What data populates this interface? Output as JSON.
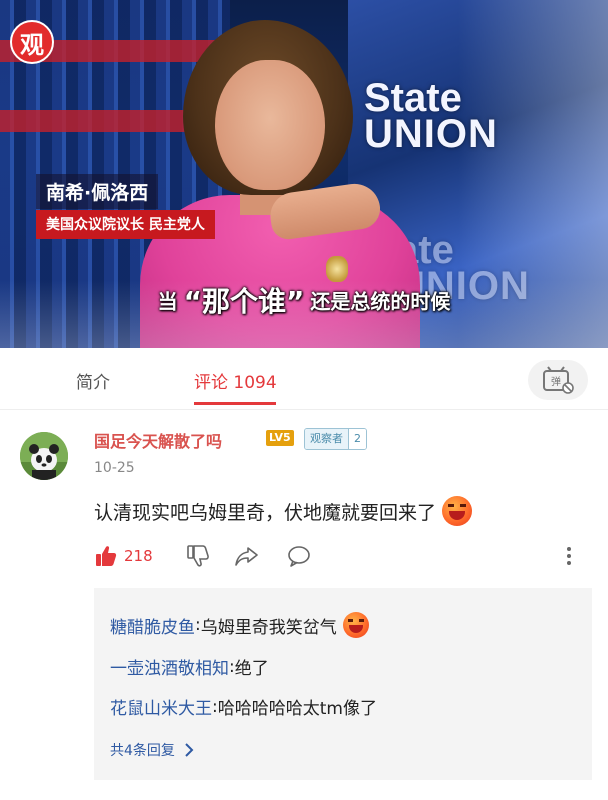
{
  "video": {
    "app_logo": "观",
    "speaker_name": "南希·佩洛西",
    "speaker_title": "美国众议院议长 民主党人",
    "subtitle_before": "当",
    "subtitle_quote": "“那个谁”",
    "subtitle_after": "还是总统的时候",
    "background_logo_line1": "State",
    "background_logo_line2": "UNION",
    "background_logo_ghost_line1": "ate",
    "background_logo_ghost_line2": "UNION"
  },
  "tabs": {
    "intro_label": "简介",
    "comments_label": "评论 1094",
    "active": "comments",
    "danmaku_icon": "danmaku-toggle-icon"
  },
  "comment": {
    "username": "国足今天解散了吗",
    "level_badge": "LV5",
    "observer_label": "观察者",
    "observer_level": "2",
    "date": "10-25",
    "text": "认清现实吧乌姆里奇，伏地魔就要回来了",
    "emoji": "angry-face-icon",
    "like_count": "218"
  },
  "replies": [
    {
      "user": "糖醋脆皮鱼",
      "sep": ":",
      "text": " 乌姆里奇我笑岔气",
      "emoji": true
    },
    {
      "user": "一壶浊酒敬相知",
      "sep": ":",
      "text": " 绝了",
      "emoji": false
    },
    {
      "user": "花鼠山米大王",
      "sep": ":",
      "text": " 哈哈哈哈哈太tm像了",
      "emoji": false
    }
  ],
  "reply_more": "共4条回复",
  "colors": {
    "accent": "#e4393c",
    "reply_user": "#2f5aa3",
    "username": "#d9534f"
  }
}
